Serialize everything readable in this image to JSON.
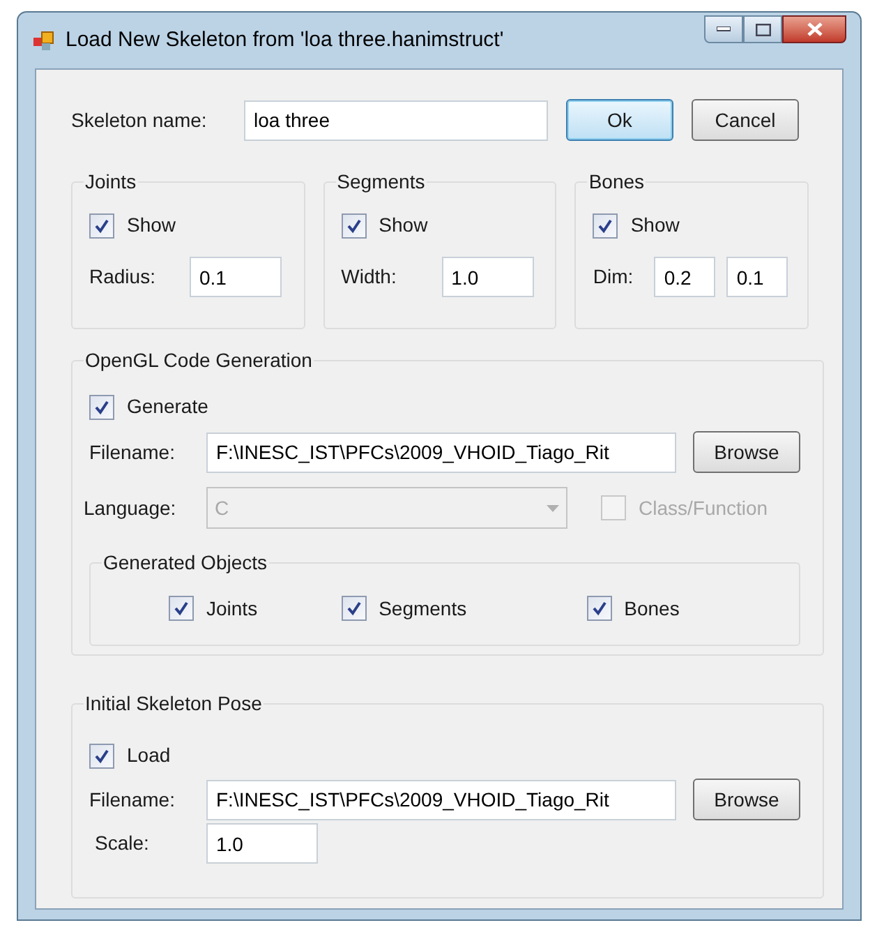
{
  "window": {
    "title": "Load New Skeleton from 'loa three.hanimstruct'"
  },
  "skeleton_name": {
    "label": "Skeleton name:",
    "value": "loa three"
  },
  "buttons": [
    {
      "label": "Ok",
      "focused": true
    },
    {
      "label": "Cancel",
      "focused": false
    }
  ],
  "display_groups": [
    {
      "title": "Joints",
      "show": {
        "label": "Show",
        "checked": true
      },
      "field_label": "Radius:",
      "values": [
        "0.1"
      ]
    },
    {
      "title": "Segments",
      "show": {
        "label": "Show",
        "checked": true
      },
      "field_label": "Width:",
      "values": [
        "1.0"
      ]
    },
    {
      "title": "Bones",
      "show": {
        "label": "Show",
        "checked": true
      },
      "field_label": "Dim:",
      "values": [
        "0.2",
        "0.1"
      ]
    }
  ],
  "opengl": {
    "title": "OpenGL Code Generation",
    "generate": {
      "label": "Generate",
      "checked": true
    },
    "filename_label": "Filename:",
    "filename": "F:\\INESC_IST\\PFCs\\2009_VHOID_Tiago_Rit",
    "browse": "Browse",
    "language_label": "Language:",
    "language": {
      "value": "C",
      "disabled": true
    },
    "class_function": {
      "label": "Class/Function",
      "checked": false,
      "disabled": true
    },
    "generated_objects": {
      "title": "Generated Objects",
      "items": [
        {
          "label": "Joints",
          "checked": true
        },
        {
          "label": "Segments",
          "checked": true
        },
        {
          "label": "Bones",
          "checked": true
        }
      ]
    }
  },
  "pose": {
    "title": "Initial Skeleton Pose",
    "load": {
      "label": "Load",
      "checked": true
    },
    "filename_label": "Filename:",
    "filename": "F:\\INESC_IST\\PFCs\\2009_VHOID_Tiago_Rit",
    "browse": "Browse",
    "scale_label": "Scale:",
    "scale": "1.0"
  }
}
